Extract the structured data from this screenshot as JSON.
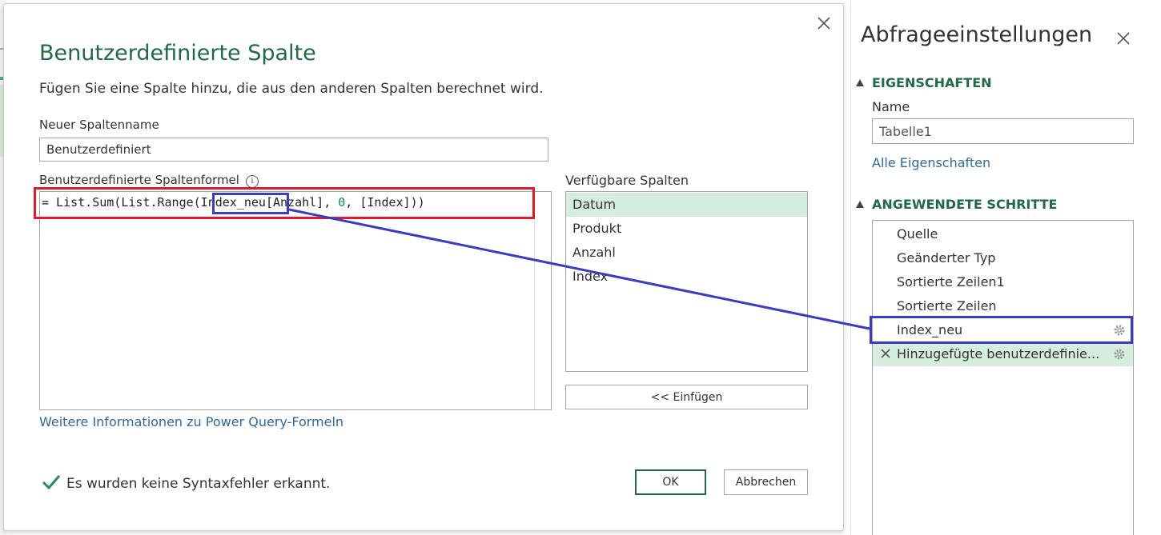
{
  "dialog": {
    "title": "Benutzerdefinierte Spalte",
    "description": "Fügen Sie eine Spalte hinzu, die aus den anderen Spalten berechnet wird.",
    "name_label": "Neuer Spaltenname",
    "name_value": "Benutzerdefiniert",
    "formula_label": "Benutzerdefinierte Spaltenformel",
    "formula": {
      "part1": "= List.Sum(List.Range(Index_neu[Anzahl], ",
      "num": "0",
      "part2": ", [Index]))"
    },
    "available_label": "Verfügbare Spalten",
    "columns": [
      "Datum",
      "Produkt",
      "Anzahl",
      "Index"
    ],
    "selected_column": "Datum",
    "insert_label": "<< Einfügen",
    "help_link": "Weitere Informationen zu Power Query-Formeln",
    "status": "Es wurden keine Syntaxfehler erkannt.",
    "ok_label": "OK",
    "cancel_label": "Abbrechen"
  },
  "pane": {
    "title": "Abfrageeinstellungen",
    "properties_header": "EIGENSCHAFTEN",
    "name_label": "Name",
    "name_value": "Tabelle1",
    "all_properties": "Alle Eigenschaften",
    "steps_header": "ANGEWENDETE SCHRITTE",
    "steps": [
      "Quelle",
      "Geänderter Typ",
      "Sortierte Zeilen1",
      "Sortierte Zeilen",
      "Index_neu",
      "Hinzugefügte benutzerdefinie..."
    ]
  },
  "colors": {
    "accent_green": "#1e6b45",
    "selection_green": "#d5ecdf",
    "annotation_red": "#e01a2a",
    "annotation_blue": "#3b3bc4",
    "link_blue": "#2e6a99"
  }
}
